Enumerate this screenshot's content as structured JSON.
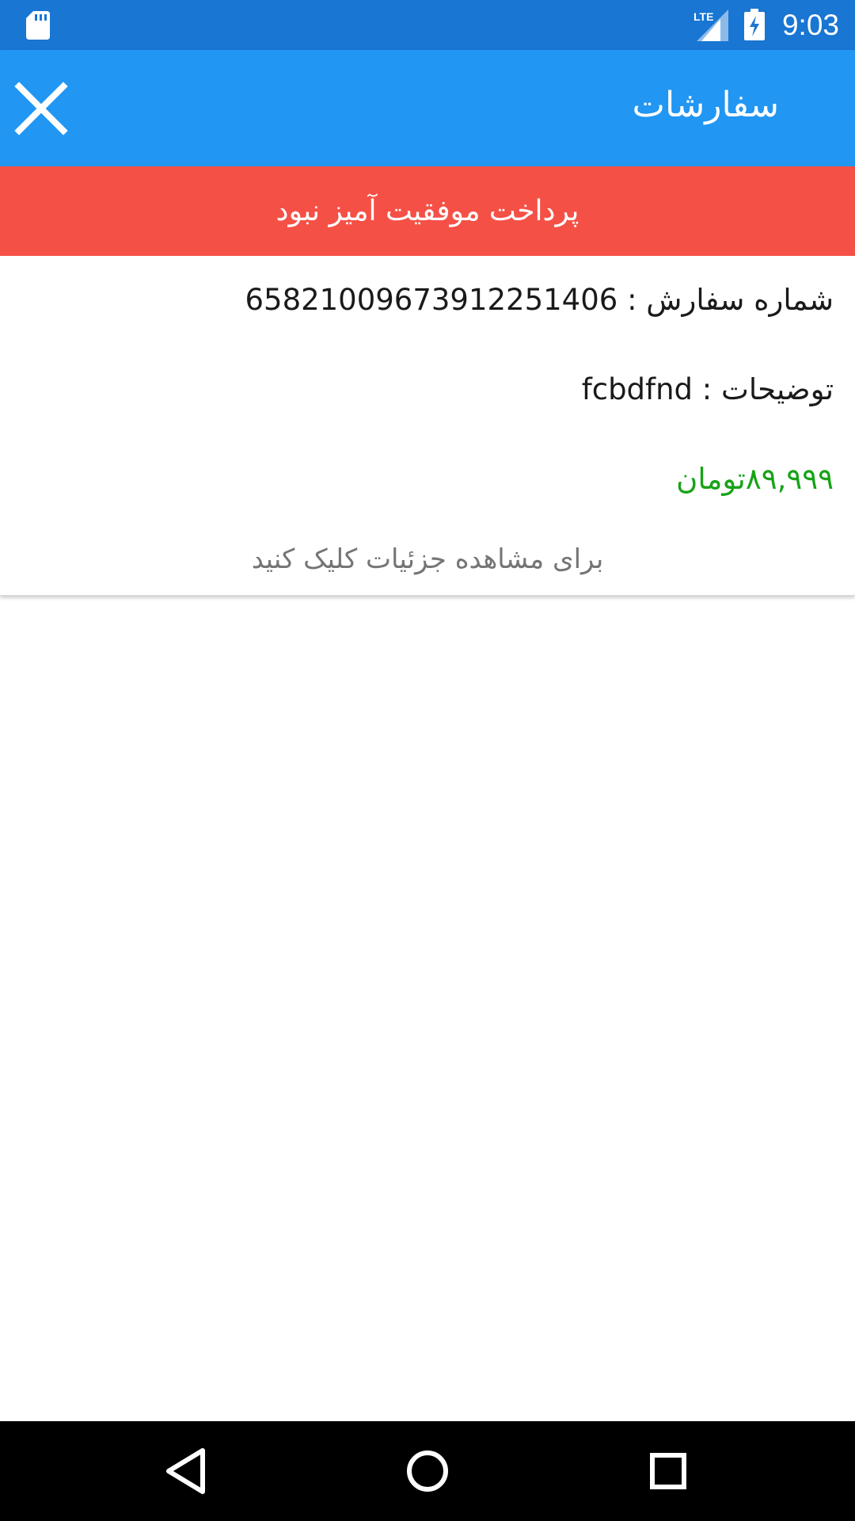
{
  "status_bar": {
    "time": "9:03",
    "network": "LTE",
    "icons": [
      "sd-card-icon",
      "lte-signal-icon",
      "battery-charging-icon"
    ]
  },
  "app_bar": {
    "title": "سفارشات",
    "close_icon": "close-icon",
    "background": "#2196F3"
  },
  "banner": {
    "message": "پرداخت موفقیت آمیز نبود",
    "background": "#F55046"
  },
  "order": {
    "number_label": "شماره سفارش :",
    "number_value": "65821009673912251406",
    "description_label": "توضیحات :",
    "description_value": "fcbdfnd",
    "price": "۸۹,۹۹۹تومان",
    "price_color": "#17A317",
    "details_link": "برای مشاهده جزئیات کلیک کنید"
  },
  "nav_bar": {
    "buttons": [
      "back-icon",
      "home-icon",
      "recents-icon"
    ]
  }
}
